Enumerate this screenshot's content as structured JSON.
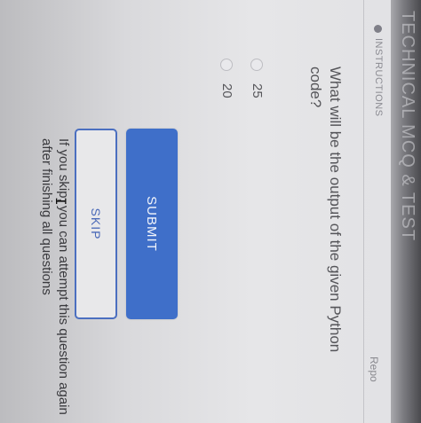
{
  "header": {
    "test_title": "TECHNICAL MCQ & TEST",
    "instructions_label": "INSTRUCTIONS",
    "report_label": "Repo"
  },
  "question": {
    "text": "What will be the output of the given Python code?",
    "options": [
      {
        "label": "25"
      },
      {
        "label": "20"
      }
    ]
  },
  "actions": {
    "submit_label": "SUBMIT",
    "skip_label": "SKIP",
    "skip_note": "If you skip, you can attempt this question again after finishing all questions"
  },
  "colors": {
    "primary": "#3f6fc9",
    "text": "#555559",
    "background": "#e4e4e6"
  },
  "icons": {
    "instructions": "info-dot-icon",
    "cursor": "text-cursor-icon"
  }
}
